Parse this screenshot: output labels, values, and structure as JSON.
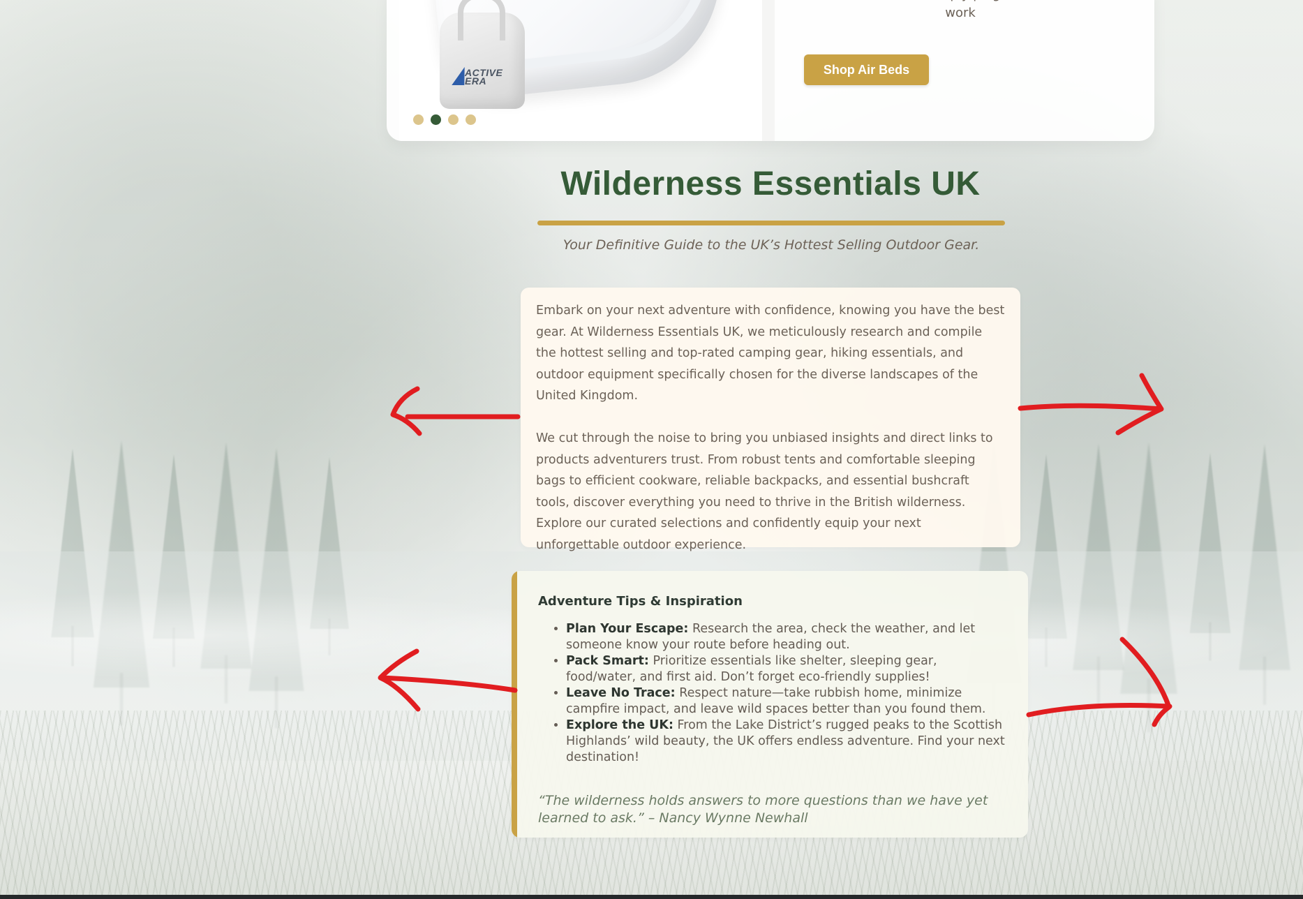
{
  "product_card": {
    "description": "deflation in minutes – simply plug it in and let it do the work",
    "button_label": "Shop Air Beds",
    "brand_logo_top": "ACTIVE",
    "brand_logo_bottom": "ERA",
    "carousel_active_index": 1
  },
  "hero": {
    "title": "Wilderness Essentials UK",
    "subtitle": "Your Definitive Guide to the UK’s Hottest Selling Outdoor Gear."
  },
  "intro": {
    "paragraph_1": "Embark on your next adventure with confidence, knowing you have the best gear. At Wilderness Essentials UK, we meticulously research and compile the hottest selling and top-rated camping gear, hiking essentials, and outdoor equipment specifically chosen for the diverse landscapes of the United Kingdom.",
    "paragraph_2": "We cut through the noise to bring you unbiased insights and direct links to products adventurers trust. From robust tents and comfortable sleeping bags to efficient cookware, reliable backpacks, and essential bushcraft tools, discover everything you need to thrive in the British wilderness. Explore our curated selections and confidently equip your next unforgettable outdoor experience."
  },
  "tips": {
    "title": "Adventure Tips & Inspiration",
    "items": [
      {
        "label": "Plan Your Escape:",
        "text": " Research the area, check the weather, and let someone know your route before heading out."
      },
      {
        "label": "Pack Smart:",
        "text": " Prioritize essentials like shelter, sleeping gear, food/water, and first aid. Don’t forget eco-friendly supplies!"
      },
      {
        "label": "Leave No Trace:",
        "text": " Respect nature—take rubbish home, minimize campfire impact, and leave wild spaces better than you found them."
      },
      {
        "label": "Explore the UK:",
        "text": " From the Lake District’s rugged peaks to the Scottish Highlands’ wild beauty, the UK offers endless adventure. Find your next destination!"
      }
    ],
    "quote": "“The wilderness holds answers to more questions than we have yet learned to ask.” – Nancy Wynne Newhall"
  },
  "theme": {
    "accent_gold": "#C9A245",
    "forest_green": "#355B37",
    "annotation_red": "#E11D20"
  },
  "icons": {
    "left_arrow": "red-left-arrow-icon",
    "right_arrow": "red-right-arrow-icon"
  }
}
